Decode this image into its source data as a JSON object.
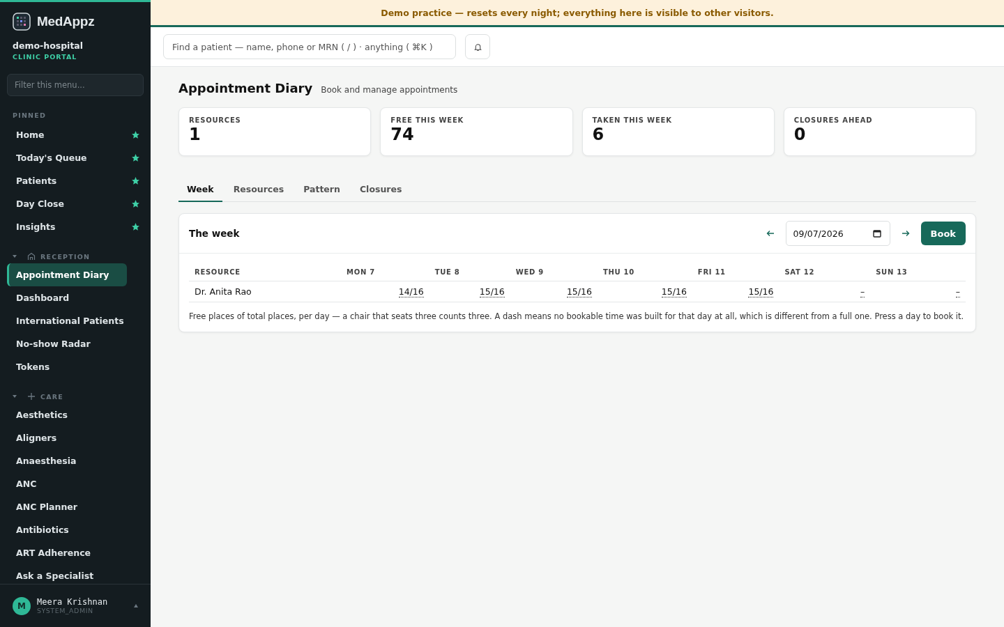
{
  "sidebar": {
    "brand": "MedAppz",
    "org": "demo-hospital",
    "portal": "CLINIC PORTAL",
    "filter": {
      "placeholder": "Filter this menu..."
    },
    "pinned": {
      "title": "PINNED",
      "items": [
        {
          "label": "Home",
          "starred": true
        },
        {
          "label": "Today's Queue",
          "starred": true
        },
        {
          "label": "Patients",
          "starred": true
        },
        {
          "label": "Day Close",
          "starred": true
        },
        {
          "label": "Insights",
          "starred": true
        }
      ]
    },
    "sections": [
      {
        "title": "RECEPTION",
        "expanded": true,
        "items": [
          {
            "label": "Appointment Diary",
            "selected": true
          },
          {
            "label": "Dashboard",
            "selected": false
          },
          {
            "label": "International Patients",
            "selected": false
          },
          {
            "label": "No-show Radar",
            "selected": false
          },
          {
            "label": "Tokens",
            "selected": false
          }
        ]
      },
      {
        "title": "CARE",
        "expanded": true,
        "items": [
          {
            "label": "Aesthetics",
            "selected": false
          },
          {
            "label": "Aligners",
            "selected": false
          },
          {
            "label": "Anaesthesia",
            "selected": false
          },
          {
            "label": "ANC",
            "selected": false
          },
          {
            "label": "ANC Planner",
            "selected": false
          },
          {
            "label": "Antibiotics",
            "selected": false
          },
          {
            "label": "ART Adherence",
            "selected": false
          },
          {
            "label": "Ask a Specialist",
            "selected": false
          }
        ]
      }
    ],
    "user": {
      "initial": "M",
      "name": "Meera Krishnan",
      "role": "SYSTEM_ADMIN"
    }
  },
  "banner": "Demo practice — resets every night; everything here is visible to other visitors.",
  "search": {
    "placeholder": "Find a patient — name, phone or MRN ( / ) · anything ( ⌘K )"
  },
  "page": {
    "title": "Appointment Diary",
    "subtitle": "Book and manage appointments"
  },
  "stats": [
    {
      "label": "RESOURCES",
      "value": "1"
    },
    {
      "label": "FREE THIS WEEK",
      "value": "74"
    },
    {
      "label": "TAKEN THIS WEEK",
      "value": "6"
    },
    {
      "label": "CLOSURES AHEAD",
      "value": "0"
    }
  ],
  "tabs": [
    {
      "label": "Week",
      "selected": true
    },
    {
      "label": "Resources",
      "selected": false
    },
    {
      "label": "Pattern",
      "selected": false
    },
    {
      "label": "Closures",
      "selected": false
    }
  ],
  "week": {
    "title": "The week",
    "date": "09/07/2026",
    "button": "Book",
    "table": {
      "columns": [
        "RESOURCE",
        "MON 7",
        "TUE 8",
        "WED 9",
        "THU 10",
        "FRI 11",
        "SAT 12",
        "SUN 13"
      ],
      "rows": [
        {
          "cells": [
            "Dr. Anita Rao",
            "14/16",
            "15/16",
            "15/16",
            "15/16",
            "15/16",
            "–",
            "–"
          ]
        }
      ]
    },
    "note": "Free places of total places, per day — a chair that seats three counts three. A dash means no bookable time was built for that day at all, which is different from a full one. Press a day to book it."
  }
}
